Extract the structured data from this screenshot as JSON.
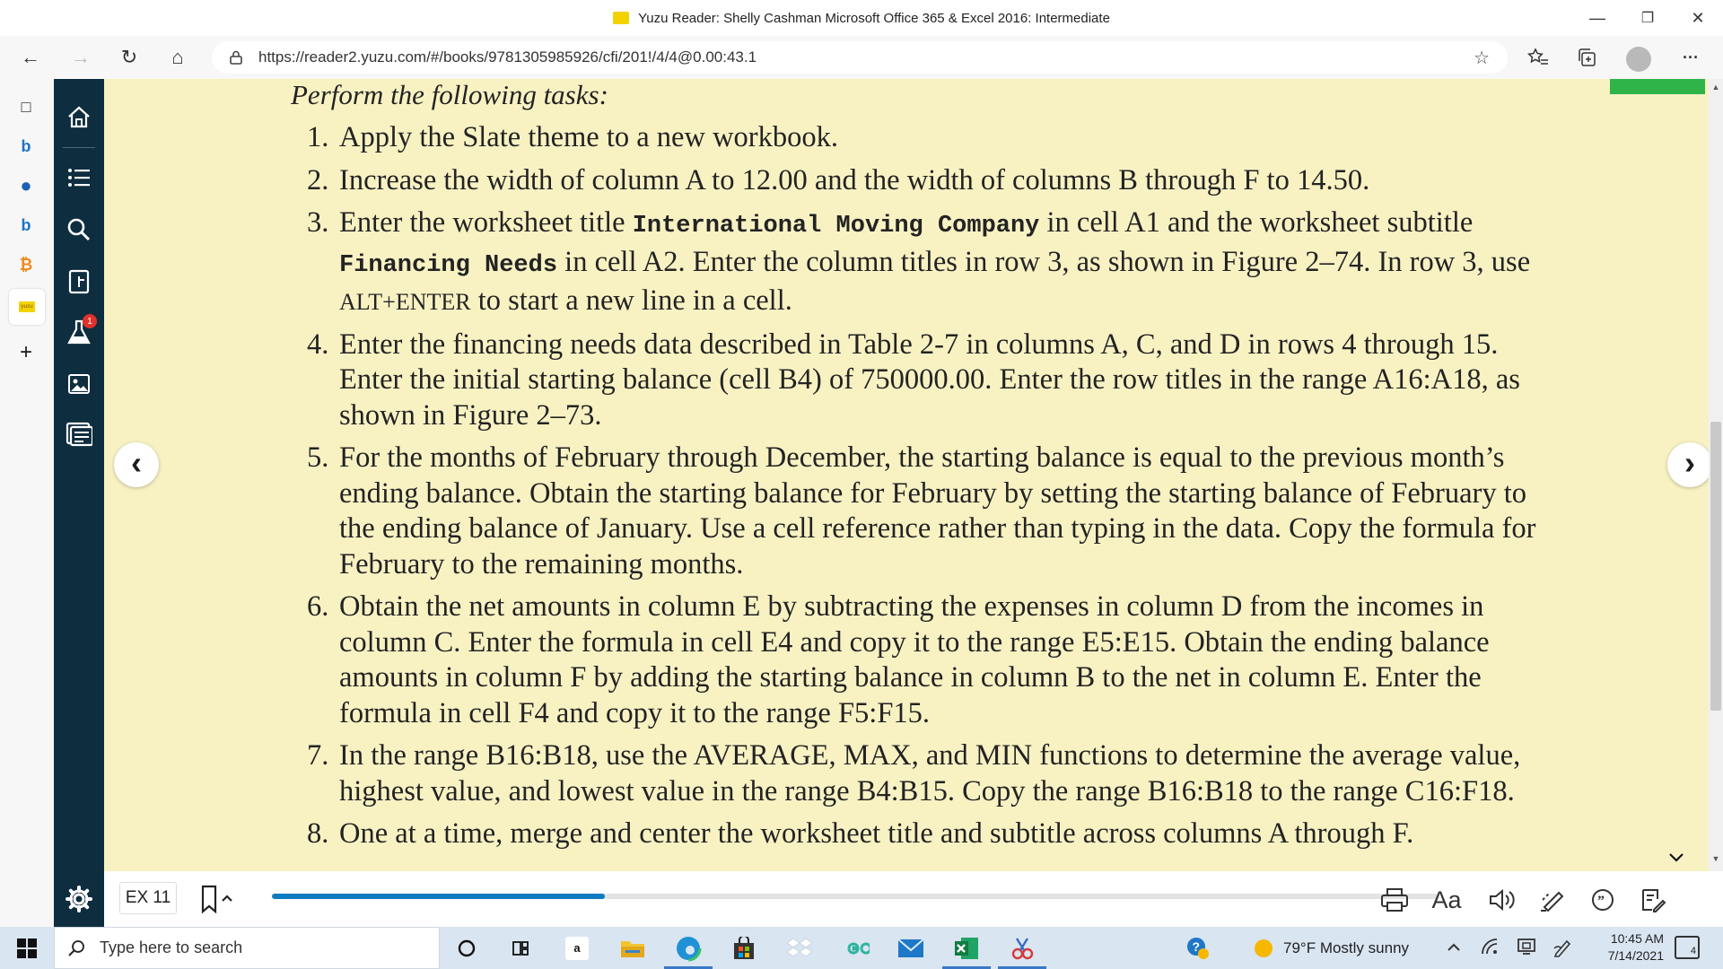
{
  "window": {
    "title": "Yuzu Reader: Shelly Cashman Microsoft Office 365 & Excel 2016: Intermediate",
    "minimize": "—",
    "restore": "❐",
    "close": "✕"
  },
  "browser": {
    "url": "https://reader2.yuzu.com/#/books/9781305985926/cfi/201!/4/4@0.00:43.1",
    "back": "←",
    "forward": "→",
    "refresh": "↻",
    "home": "⌂",
    "favorites": "☆",
    "more": "···"
  },
  "edge_sidebar": {
    "items": [
      {
        "name": "tabs-icon",
        "glyph": "□",
        "color": "#222222"
      },
      {
        "name": "bing-icon",
        "glyph": "b",
        "color": "#1b74c9"
      },
      {
        "name": "office-icon",
        "glyph": "●",
        "color": "#1b5fb8"
      },
      {
        "name": "bing-icon-2",
        "glyph": "b",
        "color": "#1b74c9"
      },
      {
        "name": "bitcoin-icon",
        "glyph": "₿",
        "color": "#f08a1b"
      },
      {
        "name": "yuzu-icon",
        "glyph": "yuzu",
        "color": "#f4d200"
      },
      {
        "name": "add-icon",
        "glyph": "+",
        "color": "#333333"
      }
    ]
  },
  "reader_sidebar": {
    "notification_count": "1"
  },
  "content": {
    "lead": "Perform the following tasks:",
    "tasks": [
      {
        "num": "1.",
        "t1": "Apply the Slate theme to a new workbook."
      },
      {
        "num": "2.",
        "t1": "Increase the width of column A to 12.00 and the width of columns B through F to 14.50."
      },
      {
        "num": "3.",
        "t1": "Enter the worksheet title ",
        "code1": "International Moving Company",
        "t2": " in cell A1 and the worksheet subtitle ",
        "code2": "Financing Needs",
        "t3": " in cell A2. Enter the column titles in row 3, as shown in Figure 2–74. In row 3, use ",
        "keys": "ALT+ENTER",
        "t4": " to start a new line in a cell."
      },
      {
        "num": "4.",
        "t1": "Enter the financing needs data described in Table 2-7 in columns A, C, and D in rows 4 through 15. Enter the initial starting balance (cell B4) of 750000.00. Enter the row titles in the range A16:A18, as shown in Figure 2–73."
      },
      {
        "num": "5.",
        "t1": "For the months of February through December, the starting balance is equal to the previous month’s ending balance. Obtain the starting balance for February by setting the starting balance of February to the ending balance of January. Use a cell reference rather than typing in the data. Copy the formula for February to the remaining months."
      },
      {
        "num": "6.",
        "t1": "Obtain the net amounts in column E by subtracting the expenses in column D from the incomes in column C. Enter the formula in cell E4 and copy it to the range E5:E15. Obtain the ending balance amounts in column F by adding the starting balance in column B to the net in column E. Enter the formula in cell F4 and copy it to the range F5:F15."
      },
      {
        "num": "7.",
        "t1": "In the range B16:B18, use the AVERAGE, MAX, and MIN functions to determine the average value, highest value, and lowest value in the range B4:B15. Copy the range B16:B18 to the range C16:F18."
      },
      {
        "num": "8.",
        "t1": "One at a time, merge and center the worksheet title and subtitle across columns A through F."
      }
    ]
  },
  "nav": {
    "prev": "‹",
    "next": "›"
  },
  "bottom_bar": {
    "page_label": "EX 11",
    "progress_fraction": 0.285,
    "font_label": "Aa"
  },
  "taskbar": {
    "search_placeholder": "Type here to search",
    "weather": "79°F  Mostly sunny",
    "time": "10:45 AM",
    "date": "7/14/2021",
    "notification_count": "4"
  }
}
